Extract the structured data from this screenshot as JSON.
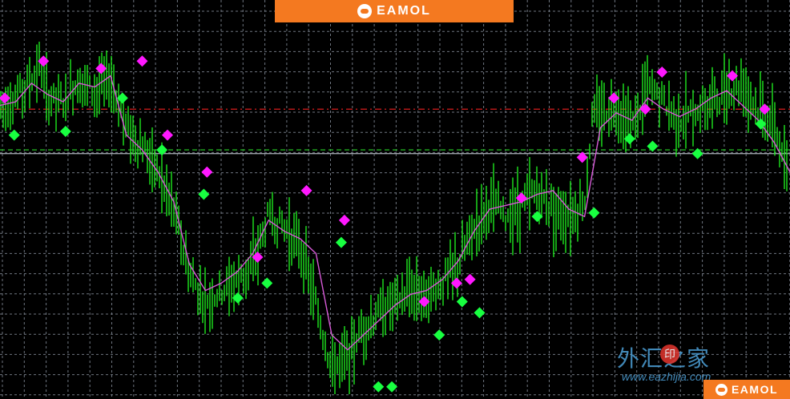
{
  "brand": {
    "name": "EAMOL",
    "logo_icon": "eamol-logo-icon",
    "color": "#f47920"
  },
  "watermark": {
    "text": "外汇之家",
    "seal": "印",
    "url": "www.eazhijia.com",
    "color": "#4da0d8"
  },
  "colors": {
    "background": "#000000",
    "grid": "#6f7680",
    "bars": "#1ee81e",
    "ma_line": "#d65ad6",
    "upper_markers": "#ff18ff",
    "lower_markers": "#18ff40",
    "resistance_line": "#d81e1e",
    "support_line": "#22b022",
    "price_line": "#9aa0a8"
  },
  "chart_data": {
    "type": "line",
    "title": "",
    "xlabel": "",
    "ylabel": "",
    "grid": true,
    "ylim": [
      0,
      100
    ],
    "xlim": [
      0,
      100
    ],
    "series": [
      {
        "kind": "price-close",
        "x": [
          0,
          2,
          4,
          5,
          6,
          8,
          10,
          11,
          12,
          14,
          16,
          18,
          19,
          20,
          22,
          24,
          26,
          28,
          30,
          32,
          34,
          36,
          38,
          40,
          42,
          44,
          46,
          48,
          50,
          52,
          54,
          56,
          58,
          60,
          62,
          64,
          66,
          68,
          70,
          72,
          74,
          75,
          76,
          78,
          80,
          82,
          84,
          86,
          88,
          90,
          92,
          94,
          96,
          98,
          100
        ],
        "y": [
          78,
          80,
          85,
          89,
          80,
          79,
          85,
          83,
          82,
          85,
          72,
          67,
          64,
          60,
          50,
          32,
          25,
          28,
          31,
          35,
          48,
          45,
          40,
          24,
          7,
          10,
          18,
          22,
          25,
          28,
          27,
          30,
          35,
          45,
          52,
          48,
          51,
          55,
          50,
          48,
          52,
          75,
          76,
          78,
          72,
          83,
          79,
          74,
          76,
          79,
          82,
          84,
          77,
          73,
          55
        ]
      },
      {
        "kind": "moving-average",
        "x": [
          0,
          2,
          4,
          6,
          8,
          10,
          12,
          14,
          16,
          18,
          20,
          22,
          24,
          26,
          28,
          30,
          32,
          34,
          36,
          38,
          40,
          42,
          44,
          46,
          48,
          50,
          52,
          54,
          56,
          58,
          60,
          62,
          64,
          66,
          68,
          70,
          72,
          74,
          76,
          78,
          80,
          82,
          84,
          86,
          88,
          90,
          92,
          94,
          96,
          98,
          100
        ],
        "y": [
          78,
          79,
          84,
          81,
          79,
          84,
          83,
          86,
          70,
          66,
          60,
          52,
          35,
          28,
          30,
          33,
          38,
          47,
          44,
          42,
          38,
          16,
          12,
          16,
          20,
          24,
          27,
          28,
          31,
          36,
          44,
          50,
          51,
          52,
          54,
          55,
          50,
          48,
          72,
          76,
          74,
          80,
          77,
          75,
          77,
          80,
          82,
          78,
          74,
          68,
          60
        ]
      }
    ],
    "markers": {
      "upper": {
        "x": [
          0.6,
          5.5,
          12.8,
          18,
          21.2,
          26.2,
          32.6,
          38.8,
          43.6,
          53.7,
          57.8,
          59.5,
          66,
          73.7,
          77.7,
          81.7,
          83.8,
          92.7,
          96.8
        ],
        "y": [
          80,
          90,
          88,
          90,
          70,
          60,
          37,
          55,
          47,
          25,
          30,
          31,
          53,
          64,
          80,
          77,
          87,
          86,
          77
        ]
      },
      "lower": {
        "x": [
          1.8,
          8.3,
          15.5,
          20.5,
          25.8,
          30.1,
          33.8,
          43.2,
          47.9,
          49.6,
          55.6,
          58.5,
          60.7,
          68,
          75.2,
          79.7,
          82.6,
          88.3,
          96.3
        ],
        "y": [
          70,
          71,
          80,
          66,
          54,
          26,
          30,
          41,
          2,
          2,
          16,
          25,
          22,
          48,
          49,
          69,
          67,
          65,
          73
        ]
      }
    },
    "reference_lines": [
      {
        "kind": "resistance",
        "y": 77,
        "style": "dash-dot"
      },
      {
        "kind": "support",
        "y": 66,
        "style": "dashed"
      },
      {
        "kind": "current-price",
        "y": 65,
        "style": "solid"
      }
    ]
  }
}
